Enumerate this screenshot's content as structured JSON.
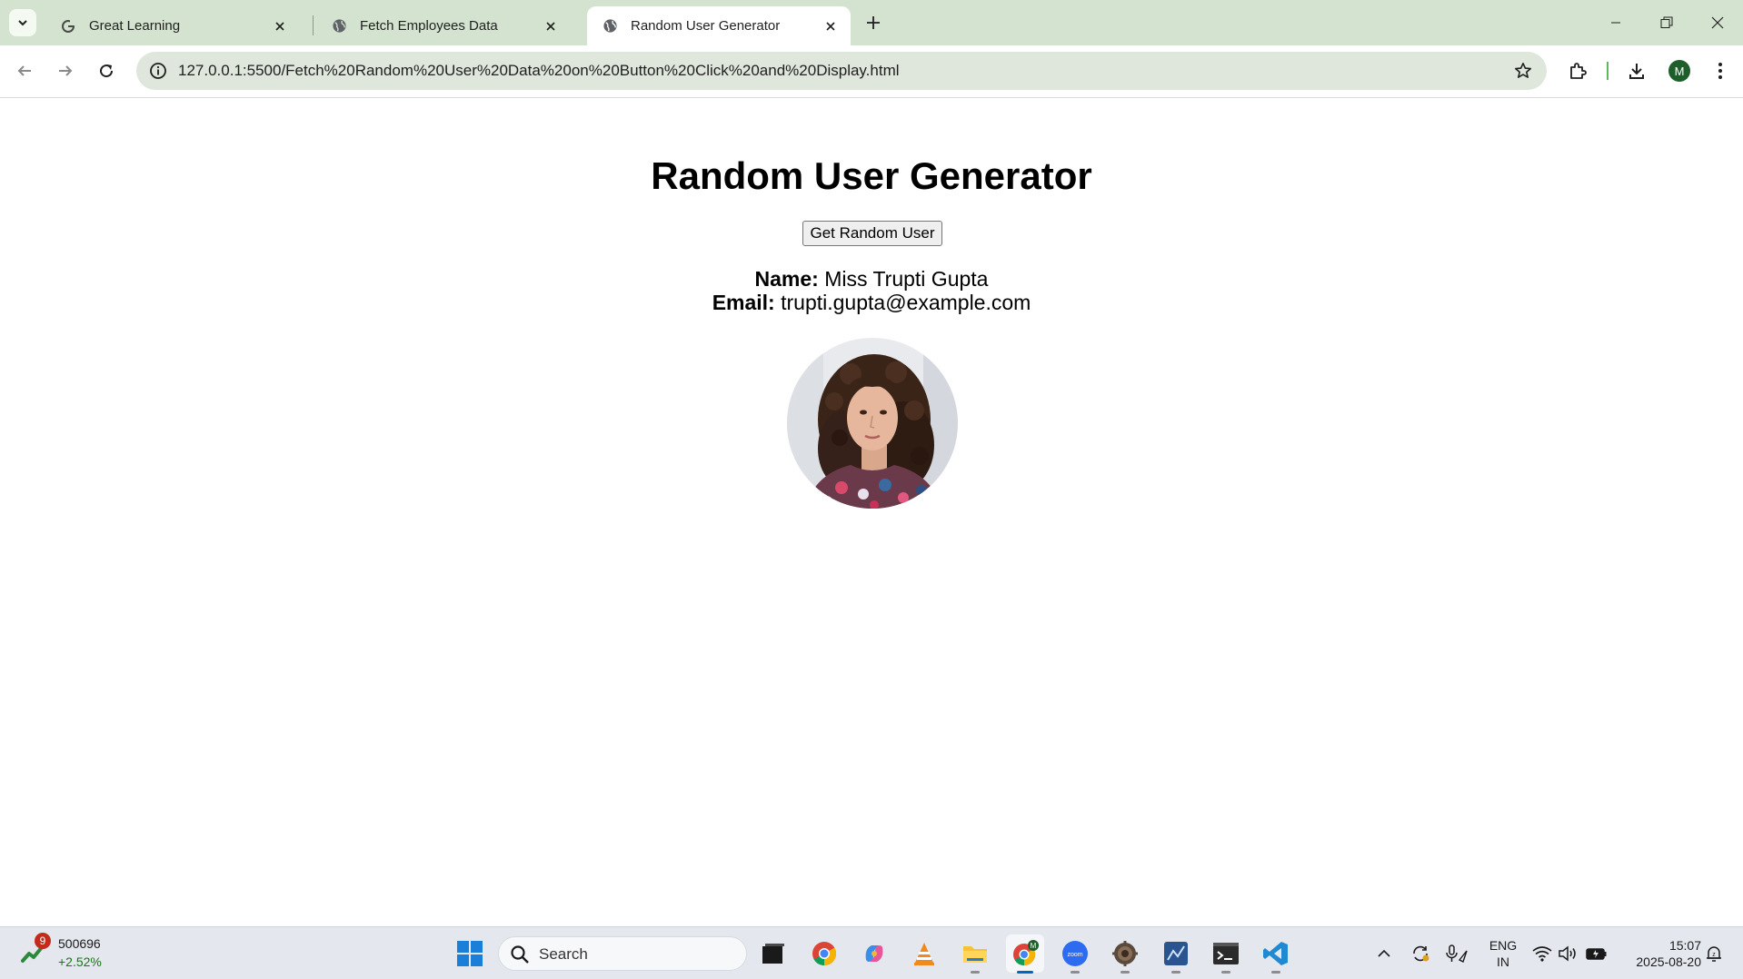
{
  "browser": {
    "tabs": [
      {
        "title": "Great Learning",
        "favicon": "google-g-icon",
        "active": false
      },
      {
        "title": "Fetch Employees Data",
        "favicon": "globe-icon",
        "active": false
      },
      {
        "title": "Random User Generator",
        "favicon": "globe-icon",
        "active": true
      }
    ],
    "url": "127.0.0.1:5500/Fetch%20Random%20User%20Data%20on%20Button%20Click%20and%20Display.html",
    "profile_initial": "M",
    "accent": "#d3e3cf"
  },
  "page": {
    "heading": "Random User Generator",
    "button_label": "Get Random User",
    "name_label": "Name:",
    "name_value": "Miss Trupti Gupta",
    "email_label": "Email:",
    "email_value": "trupti.gupta@example.com",
    "avatar": "user-photo"
  },
  "taskbar": {
    "stock_badge": "9",
    "stock_value": "500696",
    "stock_change": "+2.52%",
    "search_label": "Search",
    "apps": [
      "file-explorer-dark-icon",
      "chrome-icon",
      "copilot-icon",
      "vlc-icon",
      "folder-icon",
      "chrome-profile-icon",
      "zoom-icon",
      "app-icon",
      "chart-app-icon",
      "terminal-icon",
      "vscode-icon"
    ],
    "lang_line1": "ENG",
    "lang_line2": "IN",
    "time": "15:07",
    "date": "2025-08-20"
  }
}
